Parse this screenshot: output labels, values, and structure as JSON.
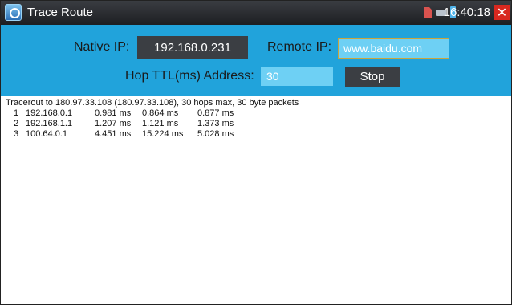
{
  "window": {
    "title": "Trace Route",
    "clock": "16:40:18",
    "close_label": "✕"
  },
  "status_icons": [
    "sd-card-icon",
    "network-icon",
    "battery-icon"
  ],
  "form": {
    "native_ip_label": "Native IP:",
    "native_ip_value": "192.168.0.231",
    "remote_ip_label": "Remote IP:",
    "remote_ip_value": "www.baidu.com",
    "hop_label": "Hop TTL(ms) Address:",
    "hop_value": "30",
    "stop_label": "Stop"
  },
  "output": {
    "header": "Tracerout to 180.97.33.108 (180.97.33.108), 30 hops max, 30 byte packets",
    "hops": [
      {
        "num": "1",
        "ip": "192.168.0.1",
        "t1": "0.981 ms",
        "t2": "0.864 ms",
        "t3": "0.877 ms"
      },
      {
        "num": "2",
        "ip": "192.168.1.1",
        "t1": "1.207 ms",
        "t2": "1.121 ms",
        "t3": "1.373 ms"
      },
      {
        "num": "3",
        "ip": "100.64.0.1",
        "t1": "4.451 ms",
        "t2": "15.224 ms",
        "t3": "5.028 ms"
      }
    ]
  },
  "colors": {
    "panel": "#21a3db",
    "titlebar": "#1d1f22",
    "input_fill": "#6ed0f4",
    "dark_button": "#3b3e43",
    "close": "#d8281f"
  }
}
